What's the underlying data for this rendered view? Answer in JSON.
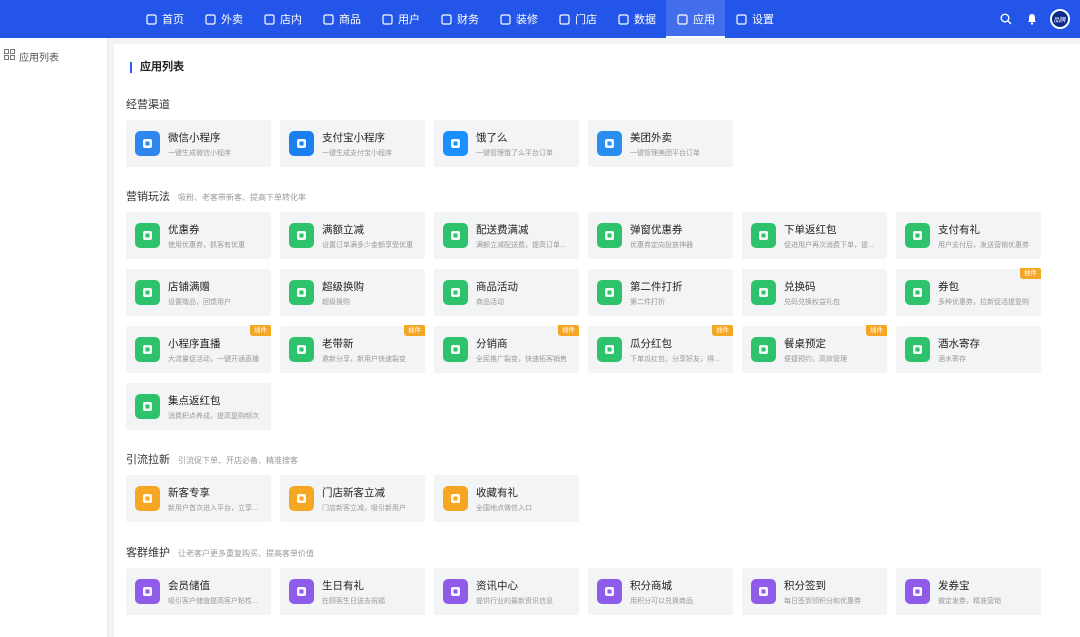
{
  "nav": {
    "items": [
      {
        "label": "首页",
        "icon": "home-icon"
      },
      {
        "label": "外卖",
        "icon": "takeout-icon"
      },
      {
        "label": "店内",
        "icon": "store-icon"
      },
      {
        "label": "商品",
        "icon": "goods-icon"
      },
      {
        "label": "用户",
        "icon": "user-icon"
      },
      {
        "label": "财务",
        "icon": "finance-icon"
      },
      {
        "label": "装修",
        "icon": "decorate-icon"
      },
      {
        "label": "门店",
        "icon": "shop-icon"
      },
      {
        "label": "数据",
        "icon": "data-icon"
      },
      {
        "label": "应用",
        "icon": "apps-icon"
      },
      {
        "label": "设置",
        "icon": "settings-icon"
      }
    ],
    "active": "应用",
    "avatar_text": "品牌"
  },
  "sidebar": {
    "item": "应用列表"
  },
  "page": {
    "title": "应用列表"
  },
  "colors": {
    "primary": "#2355e8",
    "green": "#2dc26b",
    "orange": "#f5a623",
    "purple": "#8e5ce8",
    "badge": "#f5a623"
  },
  "sections": [
    {
      "title": "经营渠道",
      "desc": "",
      "items": [
        {
          "title": "微信小程序",
          "desc": "一键生成微信小程序",
          "icon": "wechat-miniapp-icon",
          "color": "#2f86ef"
        },
        {
          "title": "支付宝小程序",
          "desc": "一键生成支付宝小程序",
          "icon": "alipay-icon",
          "color": "#1c7ff0"
        },
        {
          "title": "饿了么",
          "desc": "一键管理饿了么平台订单",
          "icon": "eleme-icon",
          "color": "#1a8fff"
        },
        {
          "title": "美团外卖",
          "desc": "一键管理美团平台订单",
          "icon": "meituan-icon",
          "color": "#2a8ef0"
        }
      ]
    },
    {
      "title": "营销玩法",
      "desc": "吸粉、老客带新客、提高下单转化率",
      "items": [
        {
          "title": "优惠券",
          "desc": "使用优惠券，抓客有优惠",
          "icon": "coupon-icon",
          "color": "#2dc26b"
        },
        {
          "title": "满额立减",
          "desc": "设置订单满多少金额享受优惠",
          "icon": "full-reduce-icon",
          "color": "#2dc26b"
        },
        {
          "title": "配送费满减",
          "desc": "满额立减配送费，提高订单...",
          "icon": "delivery-fee-icon",
          "color": "#2dc26b"
        },
        {
          "title": "弹窗优惠券",
          "desc": "优惠券定向投放神器",
          "icon": "popup-coupon-icon",
          "color": "#2dc26b"
        },
        {
          "title": "下单返红包",
          "desc": "促进用户再次消费下单，提...",
          "icon": "order-redpack-icon",
          "color": "#2dc26b"
        },
        {
          "title": "支付有礼",
          "desc": "用户支付后，发送营销优惠券",
          "icon": "pay-gift-icon",
          "color": "#2dc26b"
        },
        {
          "title": "店铺满赠",
          "desc": "设置赠品，回馈用户",
          "icon": "shop-gift-icon",
          "color": "#2dc26b"
        },
        {
          "title": "超级换购",
          "desc": "超级换购",
          "icon": "exchange-icon",
          "color": "#2dc26b"
        },
        {
          "title": "商品活动",
          "desc": "商品活动",
          "icon": "goods-activity-icon",
          "color": "#2dc26b"
        },
        {
          "title": "第二件打折",
          "desc": "第二件打折",
          "icon": "second-discount-icon",
          "color": "#2dc26b"
        },
        {
          "title": "兑换码",
          "desc": "兑码兑换权益礼包",
          "icon": "redeem-code-icon",
          "color": "#2dc26b"
        },
        {
          "title": "券包",
          "desc": "多种优惠券，拉新促活提复购",
          "icon": "coupon-pack-icon",
          "color": "#2dc26b",
          "badge": "插件"
        },
        {
          "title": "小程序直播",
          "desc": "大流量促活动，一键开通直播",
          "icon": "live-icon",
          "color": "#2dc26b",
          "badge": "插件"
        },
        {
          "title": "老带新",
          "desc": "邀新分享，新用户快速裂变",
          "icon": "invite-icon",
          "color": "#2dc26b",
          "badge": "插件"
        },
        {
          "title": "分销商",
          "desc": "全民推广裂变，快速拓客销售",
          "icon": "distributor-icon",
          "color": "#2dc26b",
          "badge": "插件"
        },
        {
          "title": "瓜分红包",
          "desc": "下单瓜红包，分享好友，得...",
          "icon": "split-redpack-icon",
          "color": "#2dc26b",
          "badge": "插件"
        },
        {
          "title": "餐桌预定",
          "desc": "便捷预约，高效管理",
          "icon": "table-reserve-icon",
          "color": "#2dc26b",
          "badge": "插件"
        },
        {
          "title": "酒水寄存",
          "desc": "酒水寄存",
          "icon": "liquor-storage-icon",
          "color": "#2dc26b"
        },
        {
          "title": "集点返红包",
          "desc": "消费积点养成，提高复购频次",
          "icon": "points-redpack-icon",
          "color": "#2dc26b"
        }
      ]
    },
    {
      "title": "引流拉新",
      "desc": "引流促下单、开店必备、精准搜客",
      "items": [
        {
          "title": "新客专享",
          "desc": "新用户首次进入平台，立享...",
          "icon": "new-customer-icon",
          "color": "#f5a623"
        },
        {
          "title": "门店新客立减",
          "desc": "门店新客立减，吸引新用户",
          "icon": "store-new-icon",
          "color": "#f5a623"
        },
        {
          "title": "收藏有礼",
          "desc": "全国地点微信入口",
          "icon": "favorite-gift-icon",
          "color": "#f5a623"
        }
      ]
    },
    {
      "title": "客群维护",
      "desc": "让老客户更多重复购买、提高客单价值",
      "items": [
        {
          "title": "会员储值",
          "desc": "吸引客户储值提高客户粘性...",
          "icon": "member-recharge-icon",
          "color": "#8e5ce8"
        },
        {
          "title": "生日有礼",
          "desc": "在顾客生日送去祝福",
          "icon": "birthday-icon",
          "color": "#8e5ce8"
        },
        {
          "title": "资讯中心",
          "desc": "提供行业的最新资讯信息",
          "icon": "news-icon",
          "color": "#8e5ce8"
        },
        {
          "title": "积分商城",
          "desc": "用积分可以兑换商品",
          "icon": "points-mall-icon",
          "color": "#8e5ce8"
        },
        {
          "title": "积分签到",
          "desc": "每日签到领积分和优惠券",
          "icon": "checkin-icon",
          "color": "#8e5ce8"
        },
        {
          "title": "发券宝",
          "desc": "微定发券，精准营销",
          "icon": "coupon-send-icon",
          "color": "#8e5ce8"
        }
      ]
    }
  ]
}
